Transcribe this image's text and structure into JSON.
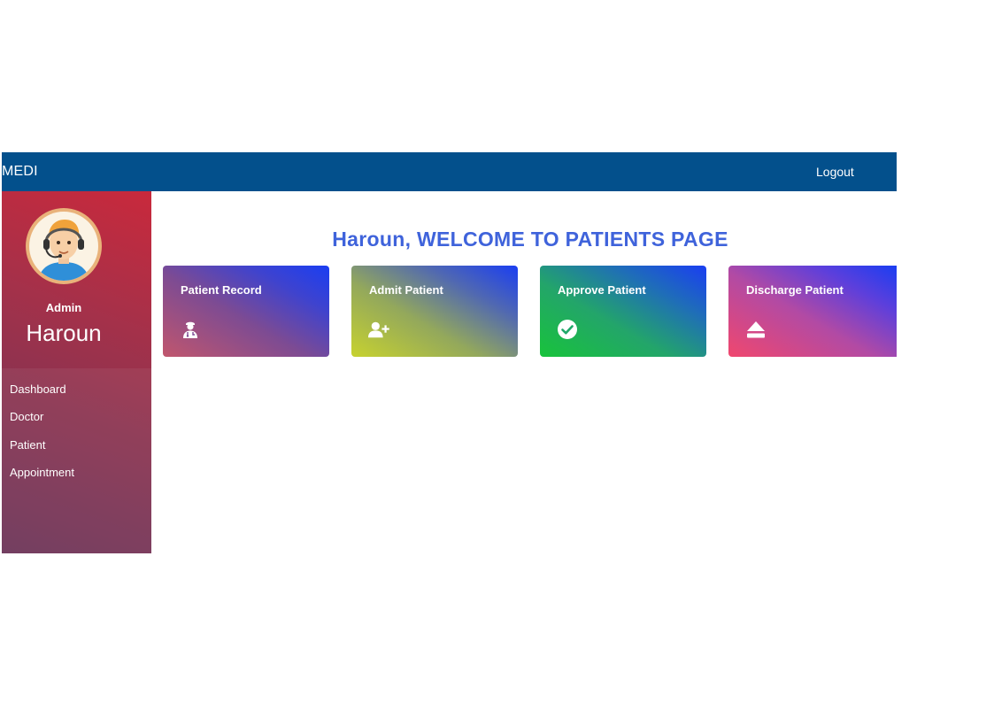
{
  "topbar": {
    "brand": "MEDI",
    "logout_label": "Logout",
    "color": "#03508c"
  },
  "sidebar": {
    "role": "Admin",
    "username": "Haroun",
    "avatar_icon": "user-headset-avatar-icon",
    "items": [
      {
        "label": "Dashboard"
      },
      {
        "label": "Doctor"
      },
      {
        "label": "Patient"
      },
      {
        "label": "Appointment"
      }
    ]
  },
  "main": {
    "welcome": "Haroun, WELCOME TO PATIENTS PAGE",
    "welcome_color": "#3f63db",
    "cards": [
      {
        "label": "Patient Record",
        "icon": "doctor-icon"
      },
      {
        "label": "Admit Patient",
        "icon": "user-plus-icon"
      },
      {
        "label": "Approve Patient",
        "icon": "check-circle-icon"
      },
      {
        "label": "Discharge Patient",
        "icon": "eject-icon"
      }
    ]
  }
}
